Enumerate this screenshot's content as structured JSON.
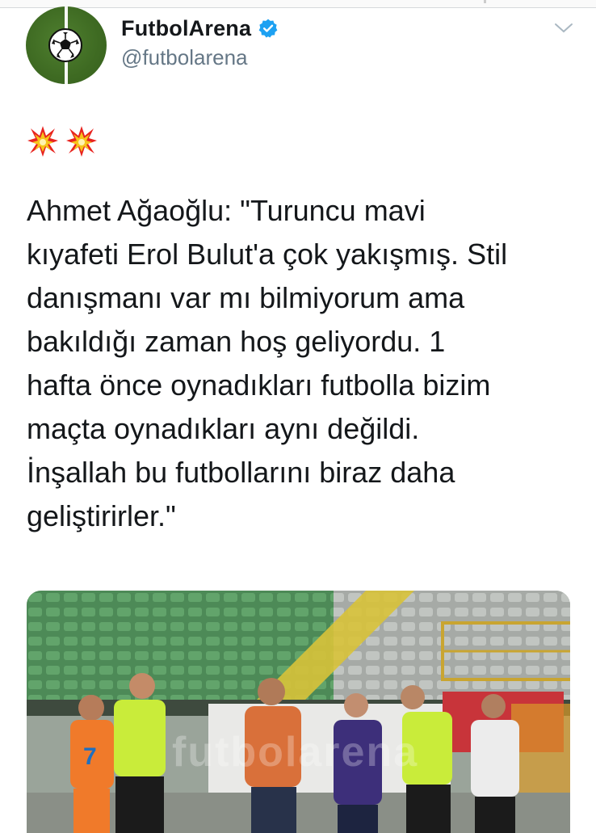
{
  "profile": {
    "display_name": "FutbolArena",
    "handle": "@futbolarena",
    "verified": true,
    "avatar_icon": "soccer-ball-icon"
  },
  "menu": {
    "icon": "chevron-down-icon"
  },
  "tweet": {
    "emoji_icons": [
      "collision-icon",
      "collision-icon"
    ],
    "text": "Ahmet Ağaoğlu: \"Turuncu mavi\nkıyafeti Erol Bulut'a çok yakışmış. Stil\ndanışmanı var mı bilmiyorum ama\nbakıldığı zaman hoş geliyordu. 1\nhafta önce oynadıkları futbolla bizim\nmaçta oynadıkları aynı değildi.\nİnşallah bu futbollarını biraz daha\ngeliştirirler.\""
  },
  "media": {
    "watermark": "futbolarena",
    "jersey_number": "7"
  },
  "colors": {
    "verified": "#1da1f2",
    "handle": "#657786",
    "text": "#14171a",
    "avatar_green": "#3e6a22"
  }
}
